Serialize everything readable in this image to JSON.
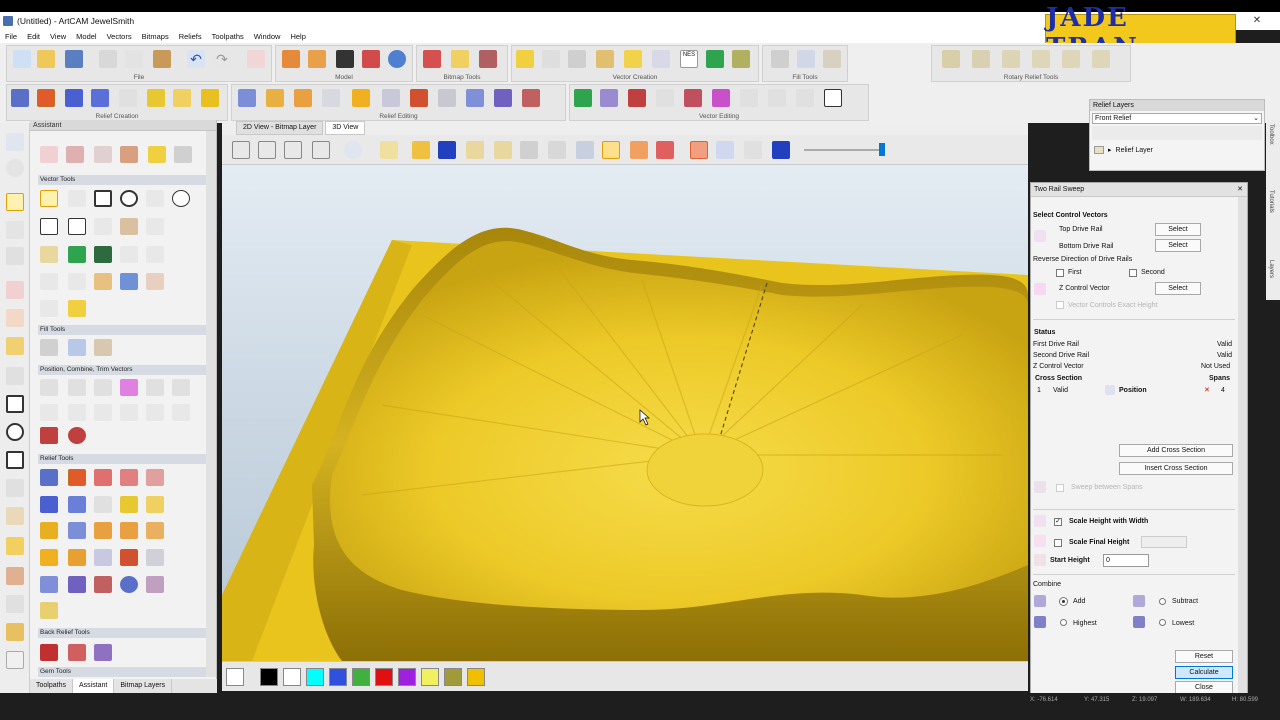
{
  "window": {
    "title": "(Untitled) - ArtCAM JewelSmith",
    "minimize": "—",
    "maximize": "☐",
    "close": "✕"
  },
  "logo": {
    "text": "JADE TRAN."
  },
  "menu": [
    "File",
    "Edit",
    "View",
    "Model",
    "Vectors",
    "Bitmaps",
    "Reliefs",
    "Toolpaths",
    "Window",
    "Help"
  ],
  "toolbar_groups": [
    "File",
    "Model",
    "Bitmap Tools",
    "Vector Creation",
    "Fill Tools",
    "Rotary Relief Tools",
    "Relief Creation",
    "Relief Editing",
    "Vector Editing"
  ],
  "assistant": {
    "title": "Assistant",
    "sections": [
      "Vector Tools",
      "Fill Tools",
      "Position, Combine, Trim Vectors",
      "Relief Tools",
      "Back Relief Tools",
      "Gem Tools"
    ],
    "tabs": [
      "Toolpaths",
      "Assistant",
      "Bitmap Layers"
    ]
  },
  "view_tabs": [
    "2D View - Bitmap Layer",
    "3D View"
  ],
  "relief_layers": {
    "title": "Relief Layers",
    "selected": "Front Relief",
    "layer": "Relief Layer"
  },
  "side_tabs": [
    "Toolbox",
    "Tutorials",
    "Layers"
  ],
  "two_rail_sweep": {
    "title": "Two Rail Sweep",
    "select_control_vectors": "Select Control Vectors",
    "top_drive_rail": "Top Drive Rail",
    "bottom_drive_rail": "Bottom Drive Rail",
    "select": "Select",
    "reverse_direction": "Reverse Direction of Drive Rails",
    "first": "First",
    "second": "Second",
    "z_control_vector": "Z Control Vector",
    "vector_controls_exact_height": "Vector Controls Exact Height",
    "status": "Status",
    "status_rows": [
      {
        "label": "First Drive Rail",
        "value": "Valid"
      },
      {
        "label": "Second Drive Rail",
        "value": "Valid"
      },
      {
        "label": "Z Control Vector",
        "value": "Not Used"
      }
    ],
    "cross_section": "Cross Section",
    "spans": "Spans",
    "cs_row": {
      "index": "1",
      "state": "Valid",
      "position": "Position",
      "spans": "4"
    },
    "add_cross_section": "Add Cross Section",
    "insert_cross_section": "Insert Cross Section",
    "sweep_between_spans": "Sweep between Spans",
    "scale_height_with_width": "Scale Height with Width",
    "scale_final_height": "Scale Final Height",
    "start_height": "Start Height",
    "start_height_value": "0",
    "combine": "Combine",
    "add": "Add",
    "subtract": "Subtract",
    "highest": "Highest",
    "lowest": "Lowest",
    "reset": "Reset",
    "calculate": "Calculate",
    "close": "Close"
  },
  "status_bar": {
    "x": "X: -76.614",
    "y": "Y: 47.315",
    "z": "Z: 19.097",
    "w": "W: 189.634",
    "h": "H: 80.599"
  },
  "palette_colors": [
    "#000000",
    "#ffffff",
    "#00ffff",
    "#3050e0",
    "#40b040",
    "#e01010",
    "#a020e0",
    "#f0f060",
    "#a09a3a",
    "#f0c000"
  ],
  "colors": {
    "relief": "#e8c619",
    "accent": "#0078d7"
  }
}
